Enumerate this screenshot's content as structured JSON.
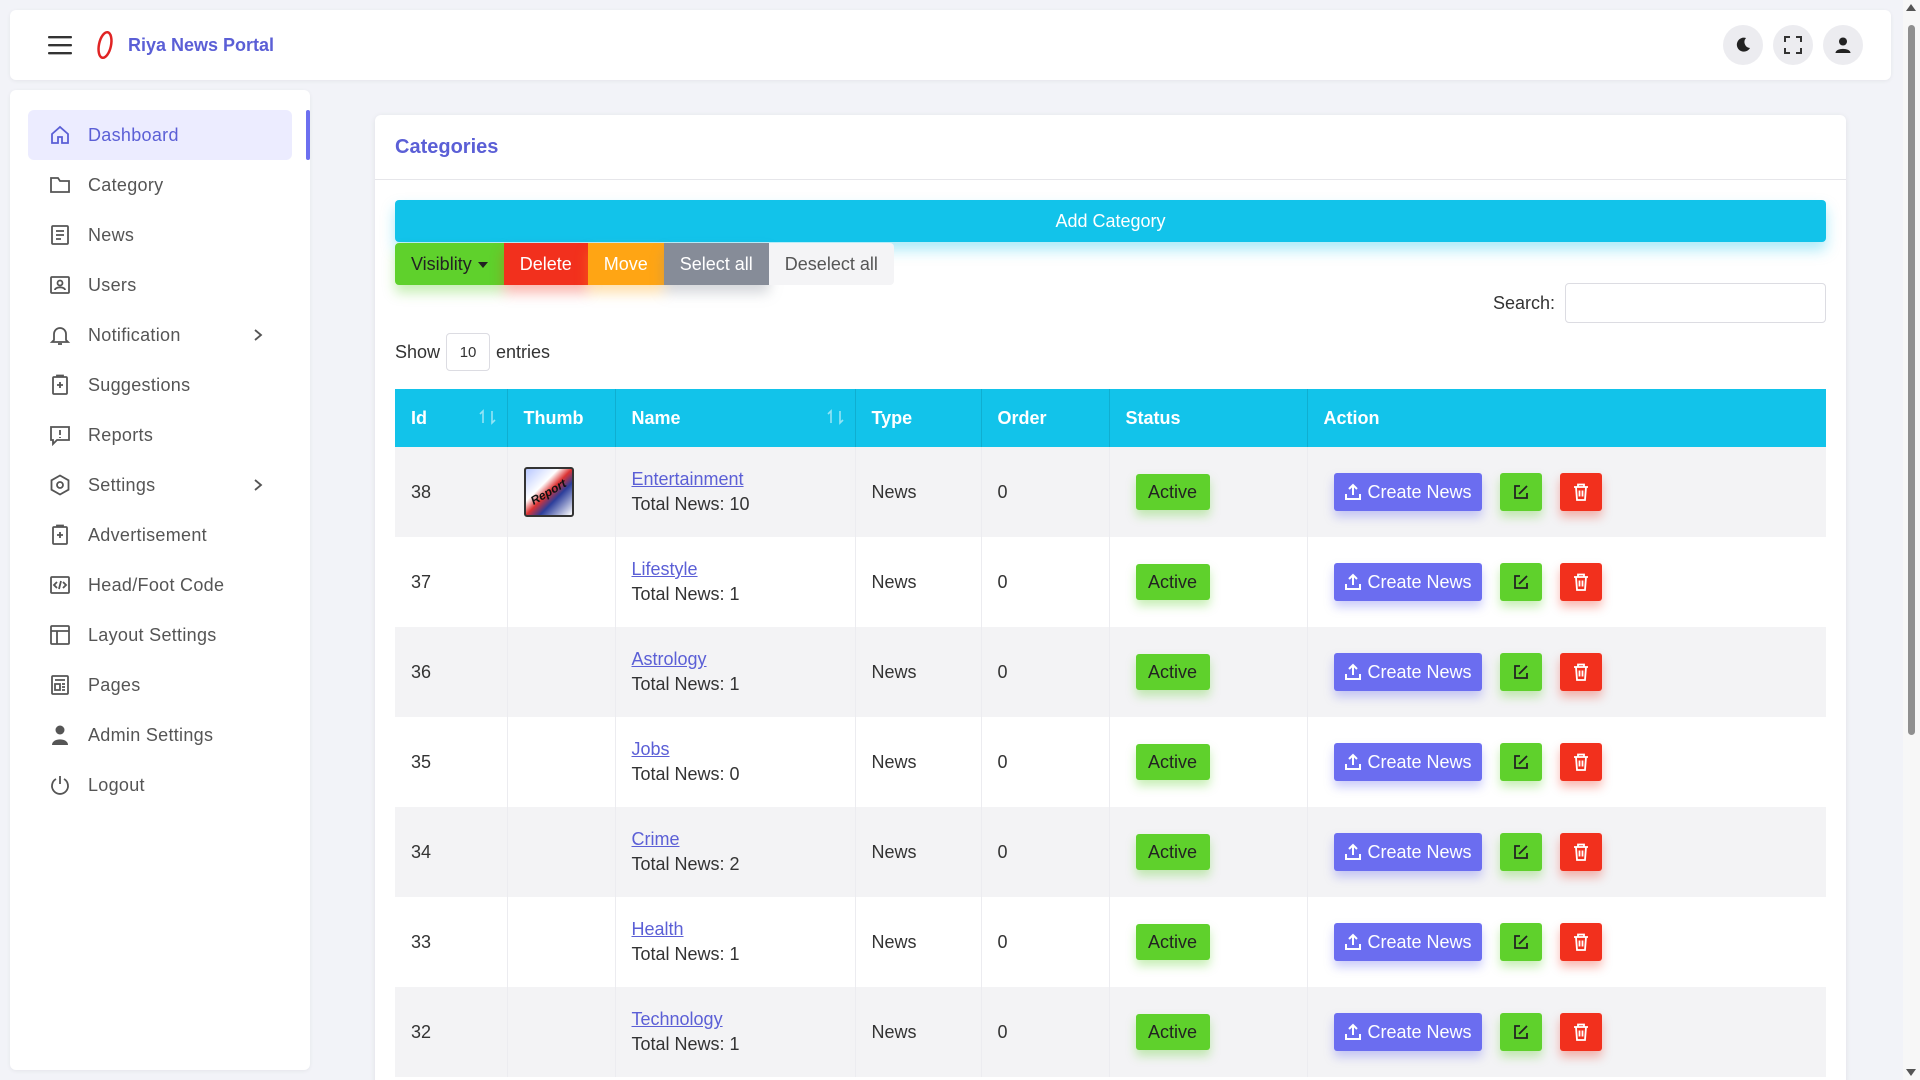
{
  "header": {
    "brand_name": "Riya News Portal"
  },
  "sidebar": {
    "items": [
      {
        "label": "Dashboard",
        "icon": "home-icon"
      },
      {
        "label": "Category",
        "icon": "folder-icon"
      },
      {
        "label": "News",
        "icon": "news-icon"
      },
      {
        "label": "Users",
        "icon": "users-icon"
      },
      {
        "label": "Notification",
        "icon": "bell-icon"
      },
      {
        "label": "Suggestions",
        "icon": "clipboard-icon"
      },
      {
        "label": "Reports",
        "icon": "report-icon"
      },
      {
        "label": "Settings",
        "icon": "gear-icon"
      },
      {
        "label": "Advertisement",
        "icon": "clipboard-plus-icon"
      },
      {
        "label": "Head/Foot Code",
        "icon": "code-icon"
      },
      {
        "label": "Layout Settings",
        "icon": "layout-icon"
      },
      {
        "label": "Pages",
        "icon": "pages-icon"
      },
      {
        "label": "Admin Settings",
        "icon": "user-icon"
      },
      {
        "label": "Logout",
        "icon": "power-icon"
      }
    ]
  },
  "main": {
    "title": "Categories",
    "add_button": "Add Category",
    "bulk": {
      "visibility": "Visiblity",
      "delete": "Delete",
      "move": "Move",
      "select_all": "Select all",
      "deselect_all": "Deselect all"
    },
    "search_label": "Search:",
    "show_label": "Show",
    "entries_value": "10",
    "entries_label": "entries",
    "table": {
      "columns": [
        "Id",
        "Thumb",
        "Name",
        "Type",
        "Order",
        "Status",
        "Action"
      ],
      "create_label": "Create News",
      "rows": [
        {
          "id": "38",
          "thumb": "Report",
          "name": "Entertainment",
          "total": "Total News: 10",
          "type": "News",
          "order": "0",
          "status": "Active"
        },
        {
          "id": "37",
          "thumb": "",
          "name": "Lifestyle",
          "total": "Total News: 1",
          "type": "News",
          "order": "0",
          "status": "Active"
        },
        {
          "id": "36",
          "thumb": "",
          "name": "Astrology",
          "total": "Total News: 1",
          "type": "News",
          "order": "0",
          "status": "Active"
        },
        {
          "id": "35",
          "thumb": "",
          "name": "Jobs",
          "total": "Total News: 0",
          "type": "News",
          "order": "0",
          "status": "Active"
        },
        {
          "id": "34",
          "thumb": "",
          "name": "Crime",
          "total": "Total News: 2",
          "type": "News",
          "order": "0",
          "status": "Active"
        },
        {
          "id": "33",
          "thumb": "",
          "name": "Health",
          "total": "Total News: 1",
          "type": "News",
          "order": "0",
          "status": "Active"
        },
        {
          "id": "32",
          "thumb": "",
          "name": "Technology",
          "total": "Total News: 1",
          "type": "News",
          "order": "0",
          "status": "Active"
        }
      ]
    }
  },
  "colors": {
    "accent": "#5b5fd6",
    "cyan": "#12c3ea",
    "green": "#5fd12c",
    "red": "#f2301d",
    "orange": "#ffa514",
    "gray": "#868c98",
    "purple": "#6b6df0"
  }
}
